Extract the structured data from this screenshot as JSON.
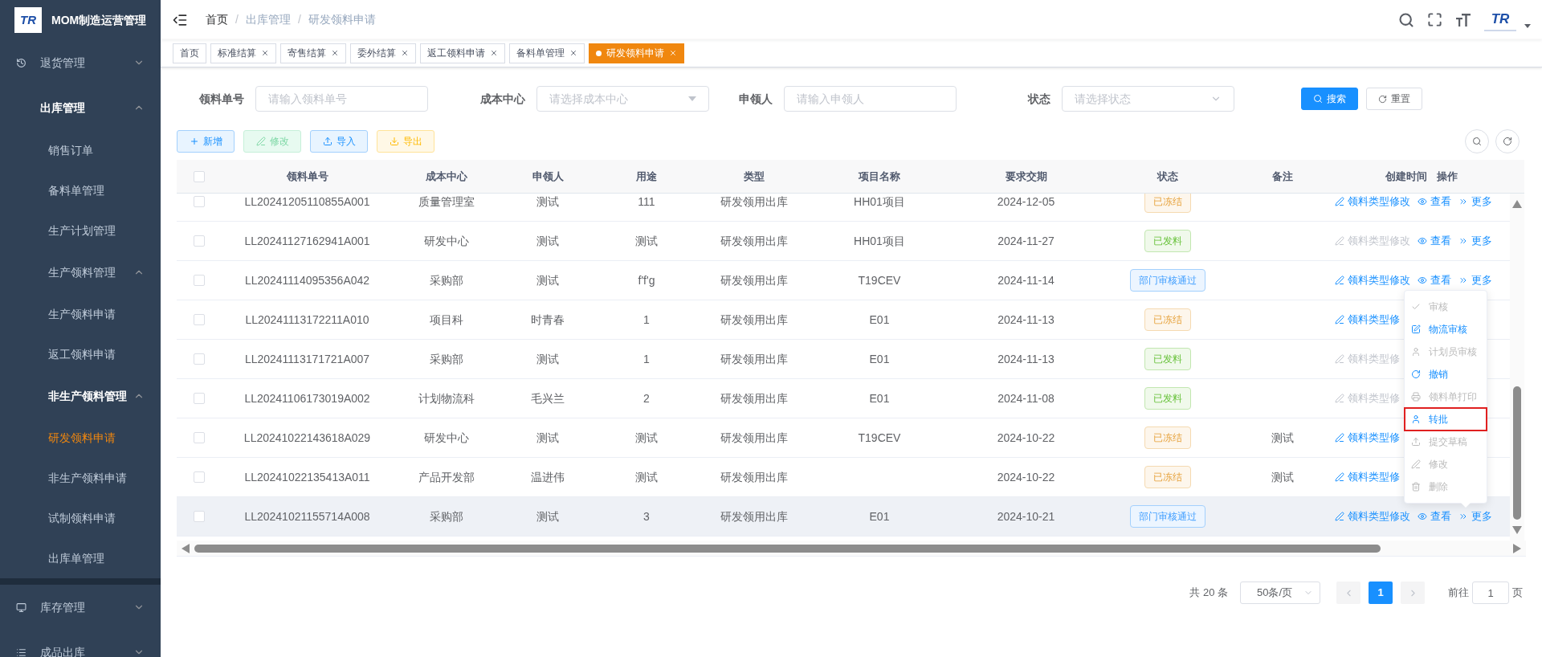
{
  "sidebar": {
    "logo_text": "TR",
    "title": "MOM制造运营管理",
    "items": [
      {
        "label": "退货管理",
        "expanded": false,
        "active": false
      },
      {
        "label": "出库管理",
        "expanded": true,
        "active": true,
        "children": [
          {
            "label": "销售订单",
            "selected": false
          },
          {
            "label": "备料单管理",
            "selected": false
          },
          {
            "label": "生产计划管理",
            "selected": false
          },
          {
            "label": "生产领料管理",
            "expanded": true,
            "active": false,
            "children": [
              {
                "label": "生产领料申请",
                "selected": false
              },
              {
                "label": "返工领料申请",
                "selected": false
              }
            ]
          },
          {
            "label": "非生产领料管理",
            "expanded": true,
            "active": true,
            "children": [
              {
                "label": "研发领料申请",
                "selected": true
              },
              {
                "label": "非生产领料申请",
                "selected": false
              },
              {
                "label": "试制领料申请",
                "selected": false
              }
            ]
          },
          {
            "label": "出库单管理",
            "selected": false
          }
        ]
      },
      {
        "label": "库存管理",
        "expanded": false,
        "active": false
      },
      {
        "label": "成品出库",
        "expanded": false,
        "active": false
      }
    ]
  },
  "header": {
    "separator": "/",
    "breadcrumb": [
      "首页",
      "出库管理",
      "研发领料申请"
    ],
    "avatar_text": "TR"
  },
  "tags": [
    {
      "label": "首页",
      "closable": false,
      "selected": false
    },
    {
      "label": "标准结算",
      "closable": true,
      "selected": false
    },
    {
      "label": "寄售结算",
      "closable": true,
      "selected": false
    },
    {
      "label": "委外结算",
      "closable": true,
      "selected": false
    },
    {
      "label": "返工领料申请",
      "closable": true,
      "selected": false
    },
    {
      "label": "备料单管理",
      "closable": true,
      "selected": false
    },
    {
      "label": "研发领料申请",
      "closable": true,
      "selected": true
    }
  ],
  "filters": [
    {
      "label": "领料单号",
      "placeholder": "请输入领料单号",
      "kind": "input"
    },
    {
      "label": "成本中心",
      "placeholder": "请选择成本中心",
      "kind": "tree-select"
    },
    {
      "label": "申领人",
      "placeholder": "请输入申领人",
      "kind": "input"
    },
    {
      "label": "状态",
      "placeholder": "请选择状态",
      "kind": "select"
    }
  ],
  "search_buttons": [
    {
      "label": "搜索",
      "kind": "primary"
    },
    {
      "label": "重置",
      "kind": "default"
    }
  ],
  "toolbar": [
    {
      "label": "新增",
      "kind": "add"
    },
    {
      "label": "修改",
      "kind": "edit"
    },
    {
      "label": "导入",
      "kind": "import"
    },
    {
      "label": "导出",
      "kind": "export"
    }
  ],
  "table": {
    "select_all_checked": false,
    "columns": [
      "领料单号",
      "成本中心",
      "申领人",
      "用途",
      "类型",
      "项目名称",
      "要求交期",
      "状态",
      "备注",
      "创建时间",
      "操作"
    ],
    "rows": [
      {
        "checked": false,
        "hovered": false,
        "no": "LL20241205110855A001",
        "cost_center": "质量管理室",
        "applicant": "测试",
        "use": "111",
        "type": "研发领用出库",
        "project": "HH01项目",
        "due_date": "2024-12-05",
        "status": {
          "label": "已冻结",
          "kind": "frozen"
        },
        "ops": {
          "edit": "领料类型修改",
          "edit_disabled": false,
          "view": "查看",
          "more": "更多"
        }
      },
      {
        "checked": false,
        "hovered": false,
        "no": "LL20241127162941A001",
        "cost_center": "研发中心",
        "applicant": "测试",
        "use": "测试",
        "type": "研发领用出库",
        "project": "HH01项目",
        "due_date": "2024-11-27",
        "status": {
          "label": "已发料",
          "kind": "issued"
        },
        "ops": {
          "edit": "领料类型修改",
          "edit_disabled": true,
          "view": "查看",
          "more": "更多"
        }
      },
      {
        "checked": false,
        "hovered": false,
        "no": "LL20241114095356A042",
        "cost_center": "采购部",
        "applicant": "测试",
        "use": "f'f'g",
        "type": "研发领用出库",
        "project": "T19CEV",
        "due_date": "2024-11-14",
        "status": {
          "label": "部门审核通过",
          "kind": "approved"
        },
        "ops": {
          "edit": "领料类型修改",
          "edit_disabled": false,
          "view": "查看",
          "more": "更多"
        }
      },
      {
        "checked": false,
        "hovered": false,
        "no": "LL20241113172211A010",
        "cost_center": "项目科",
        "applicant": "时青春",
        "use": "1",
        "type": "研发领用出库",
        "project": "E01",
        "due_date": "2024-11-13",
        "status": {
          "label": "已冻结",
          "kind": "frozen"
        },
        "ops": {
          "edit": "领料类型修",
          "edit_disabled": false
        }
      },
      {
        "checked": false,
        "hovered": false,
        "no": "LL20241113171721A007",
        "cost_center": "采购部",
        "applicant": "测试",
        "use": "1",
        "type": "研发领用出库",
        "project": "E01",
        "due_date": "2024-11-13",
        "status": {
          "label": "已发料",
          "kind": "issued"
        },
        "ops": {
          "edit": "领料类型修",
          "edit_disabled": true
        }
      },
      {
        "checked": false,
        "hovered": false,
        "no": "LL20241106173019A002",
        "cost_center": "计划物流科",
        "applicant": "毛兴兰",
        "use": "2",
        "type": "研发领用出库",
        "project": "E01",
        "due_date": "2024-11-08",
        "status": {
          "label": "已发料",
          "kind": "issued"
        },
        "ops": {
          "edit": "领料类型修",
          "edit_disabled": true
        }
      },
      {
        "checked": false,
        "hovered": false,
        "no": "LL20241022143618A029",
        "cost_center": "研发中心",
        "applicant": "测试",
        "use": "测试",
        "type": "研发领用出库",
        "project": "T19CEV",
        "due_date": "2024-10-22",
        "status": {
          "label": "已冻结",
          "kind": "frozen"
        },
        "remark": "测试",
        "ops": {
          "edit": "领料类型修",
          "edit_disabled": false
        }
      },
      {
        "checked": false,
        "hovered": false,
        "no": "LL20241022135413A011",
        "cost_center": "产品开发部",
        "applicant": "温进伟",
        "use": "测试",
        "type": "研发领用出库",
        "due_date": "2024-10-22",
        "status": {
          "label": "已冻结",
          "kind": "frozen"
        },
        "remark": "测试",
        "ops": {
          "edit": "领料类型修",
          "edit_disabled": false
        }
      },
      {
        "checked": false,
        "hovered": true,
        "no": "LL20241021155714A008",
        "cost_center": "采购部",
        "applicant": "测试",
        "use": "3",
        "type": "研发领用出库",
        "project": "E01",
        "due_date": "2024-10-21",
        "status": {
          "label": "部门审核通过",
          "kind": "approved"
        },
        "ops": {
          "edit": "领料类型修改",
          "edit_disabled": false,
          "view": "查看",
          "more": "更多"
        }
      }
    ]
  },
  "more_menu": {
    "items": [
      {
        "label": "审核",
        "disabled": true,
        "marked": false
      },
      {
        "label": "物流审核",
        "disabled": false,
        "marked": false
      },
      {
        "label": "计划员审核",
        "disabled": true,
        "marked": false
      },
      {
        "label": "撤销",
        "disabled": false,
        "marked": false
      },
      {
        "label": "领料单打印",
        "disabled": true,
        "marked": false
      },
      {
        "label": "转批",
        "disabled": false,
        "marked": true
      },
      {
        "label": "提交草稿",
        "disabled": true,
        "marked": false
      },
      {
        "label": "修改",
        "disabled": true,
        "marked": false
      },
      {
        "label": "删除",
        "disabled": true,
        "marked": false
      }
    ]
  },
  "pagination": {
    "total": "共 20 条",
    "page_size": "50条/页",
    "prev_disabled": true,
    "next_disabled": true,
    "pages": [
      {
        "label": "1",
        "selected": true
      }
    ],
    "goto_label": "前往",
    "goto_value": "1",
    "page_unit": "页"
  }
}
